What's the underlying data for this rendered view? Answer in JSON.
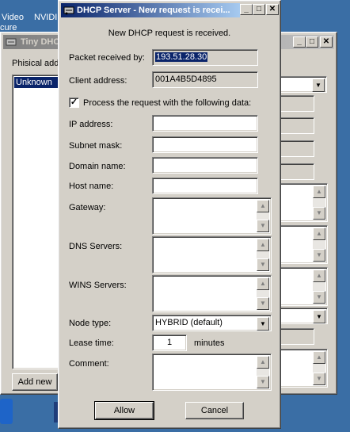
{
  "desktop": {
    "labels": [
      "Video",
      "NVIDI",
      "cure"
    ]
  },
  "bg_window": {
    "title": "Tiny DHCP",
    "mac_label": "Phisical add",
    "list_items": [
      "Unknown"
    ],
    "add_button": "Add new"
  },
  "dialog": {
    "title": "DHCP Server - New request is recei...",
    "heading": "New DHCP request is received.",
    "packet_label": "Packet received by:",
    "packet_value": "193.51.28.30",
    "client_label": "Client address:",
    "client_value": "001A4B5D4895",
    "process_checkbox_label": "Process the request with the following data:",
    "process_checked": true,
    "fields": {
      "ip_label": "IP address:",
      "subnet_label": "Subnet mask:",
      "domain_label": "Domain name:",
      "host_label": "Host name:",
      "gateway_label": "Gateway:",
      "dns_label": "DNS Servers:",
      "wins_label": "WINS Servers:",
      "node_label": "Node type:",
      "node_value": "HYBRID (default)",
      "lease_label": "Lease time:",
      "lease_value": "1",
      "lease_unit": "minutes",
      "comment_label": "Comment:"
    },
    "allow_button": "Allow",
    "cancel_button": "Cancel"
  },
  "caption_glyphs": {
    "minimize": "_",
    "maximize": "□",
    "close": "✕",
    "up": "▲",
    "down": "▼",
    "check": "✓"
  },
  "colors": {
    "desktop": "#3a6ea5",
    "title_active": "#0a246a",
    "face": "#d4d0c8"
  }
}
